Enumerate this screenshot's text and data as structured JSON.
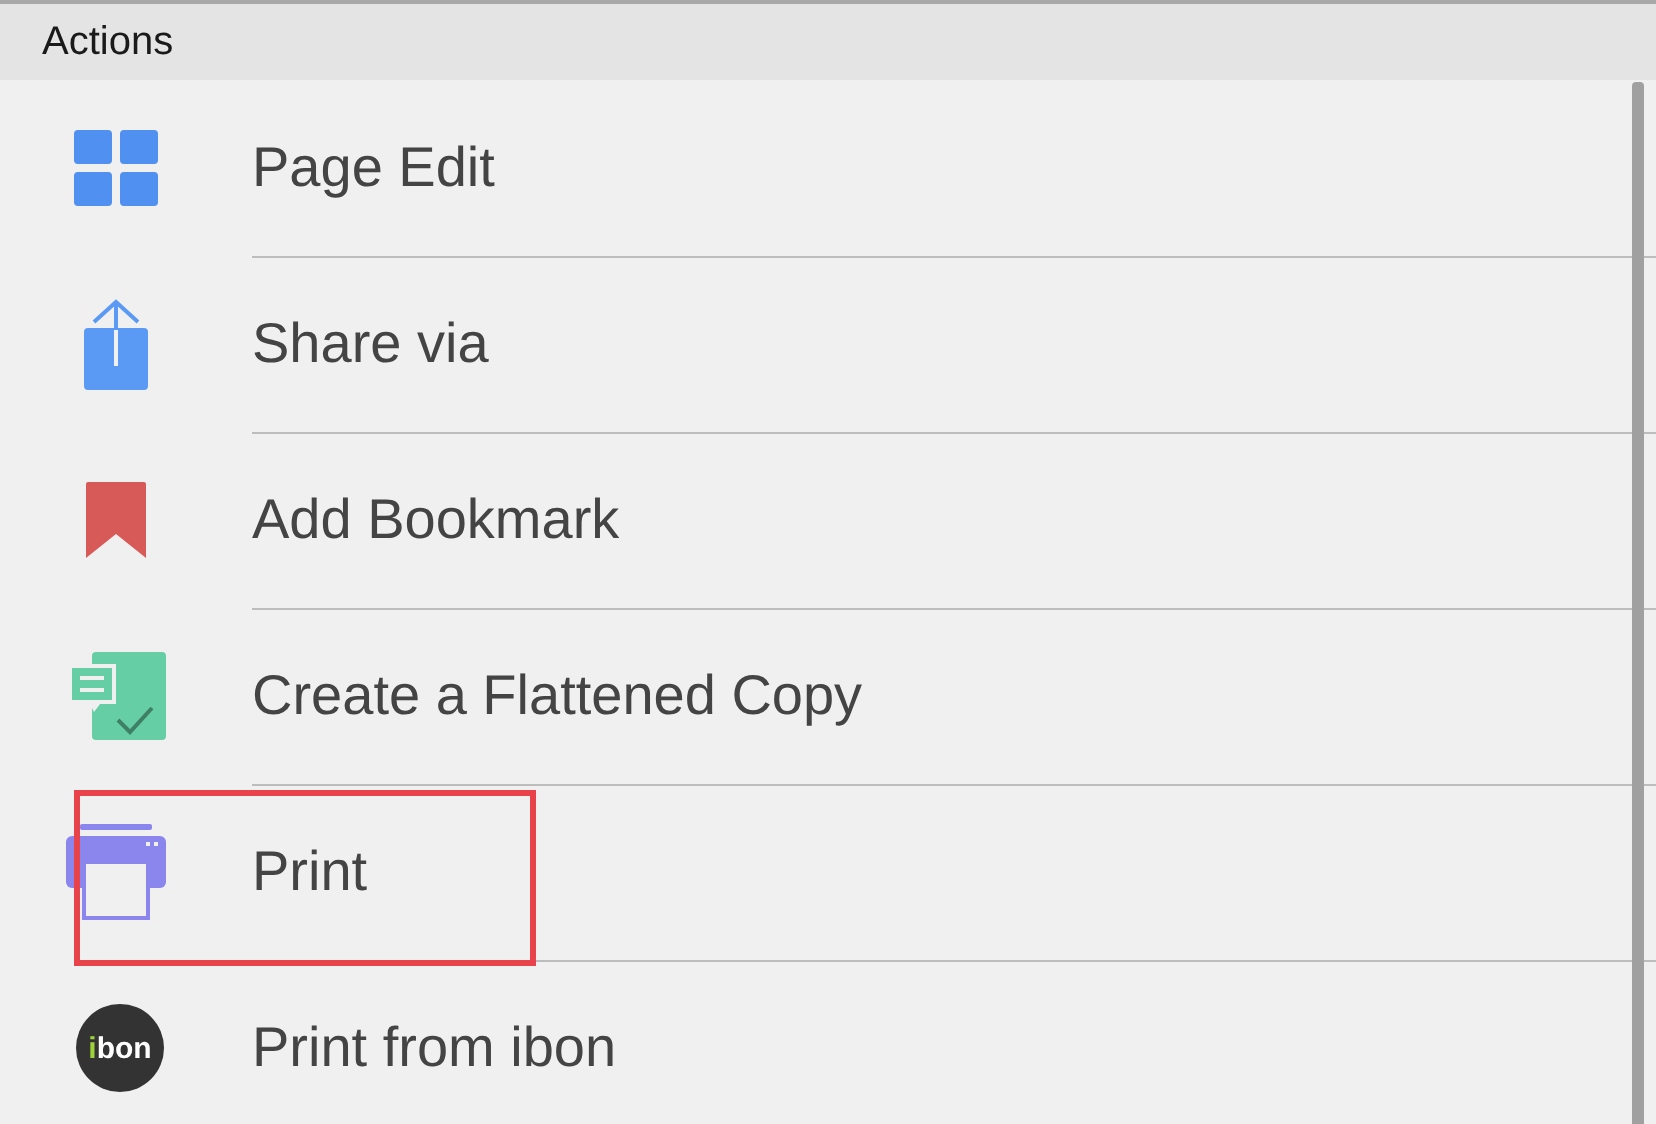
{
  "header": {
    "title": "Actions"
  },
  "items": [
    {
      "kind": "grid",
      "label": "Page Edit",
      "highlighted": false
    },
    {
      "kind": "share",
      "label": "Share via",
      "highlighted": false
    },
    {
      "kind": "bookmark",
      "label": "Add Bookmark",
      "highlighted": false
    },
    {
      "kind": "flatten",
      "label": "Create a Flattened Copy",
      "highlighted": false
    },
    {
      "kind": "printer",
      "label": "Print",
      "highlighted": true
    },
    {
      "kind": "logo",
      "logo_text": "ibon",
      "label": "Print from ibon",
      "highlighted": false
    }
  ]
}
